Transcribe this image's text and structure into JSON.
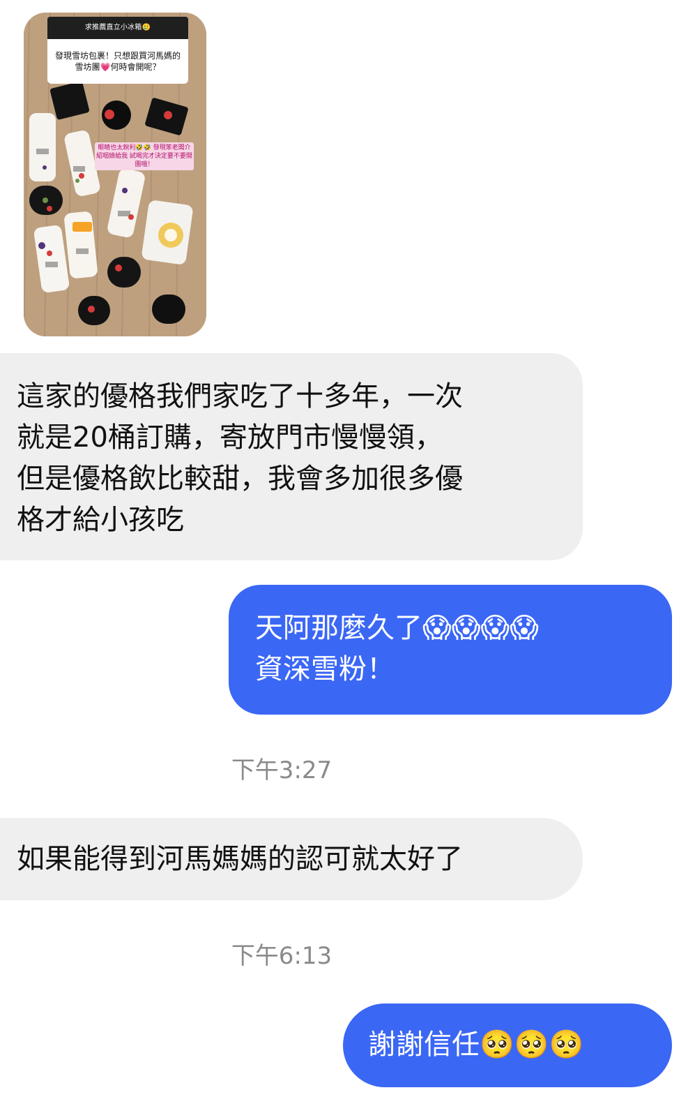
{
  "story_reply": {
    "header_text": "求推薦直立小冰箱🥲",
    "question_text": "發現雪坊包裹！只想跟買河馬媽的雪坊團💗何時會開呢？",
    "sticker_text": "眼睛也太銳利🤣🤣 發現笨老闆介紹咽娘給我 試喝完才決定要不要開團哦！"
  },
  "messages": [
    {
      "direction": "incoming",
      "lines": [
        "這家的優格我們家吃了十多年，一次",
        "就是20桶訂購，寄放門市慢慢領，",
        "但是優格飲比較甜，我會多加很多優",
        "格才給小孩吃"
      ]
    },
    {
      "direction": "outgoing",
      "lines": [
        "天阿那麼久了😱😱😱😱",
        "資深雪粉！"
      ]
    },
    {
      "direction": "incoming",
      "text": "如果能得到河馬媽媽的認可就太好了"
    },
    {
      "direction": "outgoing",
      "text": "謝謝信任🥺🥺🥺"
    }
  ],
  "timestamps": [
    "下午3:27",
    "下午6:13"
  ],
  "colors": {
    "incoming_bubble": "#efefef",
    "outgoing_bubble": "#3b67f5",
    "timestamp_text": "#8a8a8a"
  }
}
